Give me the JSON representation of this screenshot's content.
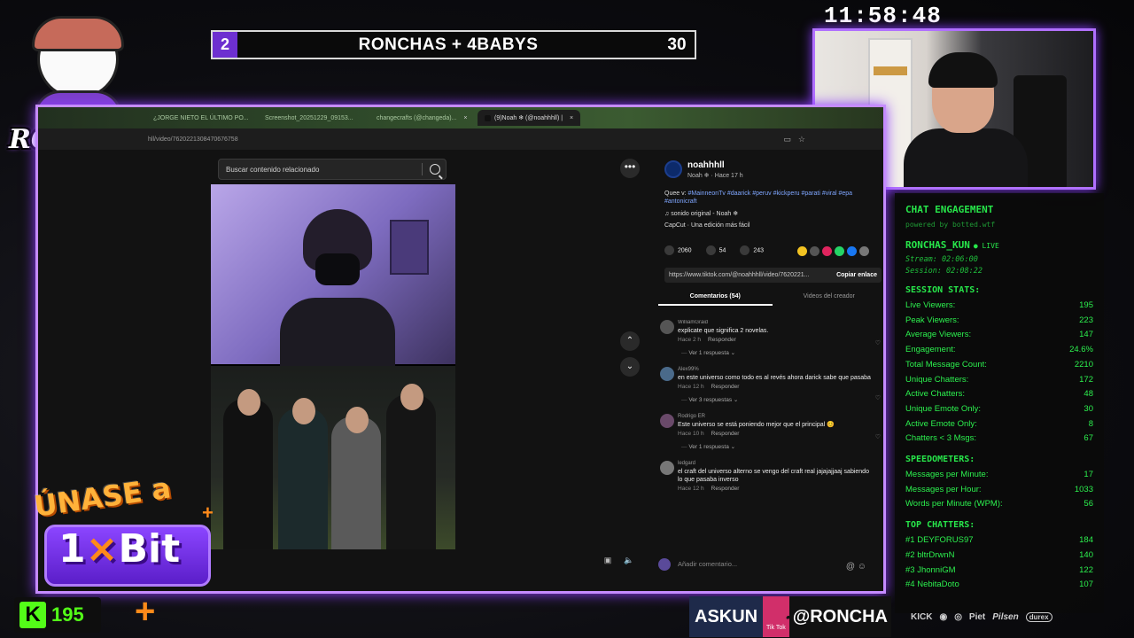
{
  "overlay": {
    "clock": "11:58:48",
    "scoreboard": {
      "left_score": "2",
      "title": "RONCHAS + 4BABYS",
      "right_score": "30"
    },
    "logo_text": "RONCHAS",
    "kick_viewers": "195",
    "promo": {
      "line1": "ÚNASE a",
      "brand_num": "1",
      "brand_x": "×",
      "brand_name": "Bit"
    },
    "ticker": {
      "left_text": "ASKUN",
      "tiktok_label": "Tik Tok",
      "right_text": "@RONCHA"
    },
    "sponsors": [
      "KICK",
      "Piet",
      "Pilsen",
      "durex"
    ]
  },
  "browser": {
    "tabs": [
      {
        "label": "¿JORGE NIETO EL ÚLTIMO PO...",
        "active": false
      },
      {
        "label": "Screenshot_20251229_09153...",
        "active": false
      },
      {
        "label": "changecrafts (@changeda)...",
        "active": false
      },
      {
        "label": "(9)Noah ❄ (@noahhhll) |",
        "active": true
      }
    ],
    "url": "hll/video/7620221308470676758"
  },
  "tiktok": {
    "search_placeholder": "Buscar contenido relacionado",
    "author": {
      "name": "noahhhll",
      "meta": "Noah ❄ · Hace 17 h"
    },
    "description_prefix": "Quee v: ",
    "hashtags": "#MainneonTv #daarick #peruv #kickperu #parati #viral #epa #antonicraft",
    "music": "♫ sonido original - Noah ❄",
    "capcut": "CapCut · Una edición más fácil",
    "stats": {
      "likes": "2060",
      "comments": "54",
      "saves": "243"
    },
    "link": "https://www.tiktok.com/@noahhhll/video/7620221...",
    "copy_label": "Copiar enlace",
    "tabs": {
      "comments": "Comentarios (54)",
      "creator": "Videos del creador"
    },
    "comments": [
      {
        "user": "WilliamGraid",
        "text": "explicate que significa 2 novelas.",
        "time": "Hace 2 h",
        "reply": "Responder",
        "more": "Ver 1 respuesta ⌄"
      },
      {
        "user": "Alex99%",
        "text": "en este universo como todo es al revés ahora darick sabe que pasaba",
        "time": "Hace 12 h",
        "reply": "Responder",
        "more": "Ver 3 respuestas ⌄"
      },
      {
        "user": "Rodrigo ER",
        "text": "Este universo se está poniendo mejor que el principal 😊",
        "time": "Hace 10 h",
        "reply": "Responder",
        "more": "Ver 1 respuesta ⌄"
      },
      {
        "user": "ledgard",
        "text": "el craft del universo alterno se vengo del craft real jajajajjaaj sabiendo lo que pasaba inverso",
        "time": "Hace 12 h",
        "reply": "Responder",
        "more": ""
      }
    ],
    "add_comment_placeholder": "Añadir comentario..."
  },
  "engagement": {
    "title": "CHAT ENGAGEMENT",
    "powered": "powered by botted.wtf",
    "user": "RONCHAS_KUN",
    "live": "● LIVE",
    "stream": "Stream: 02:06:00",
    "session": "Session: 02:08:22",
    "session_stats_title": "SESSION STATS:",
    "session_stats": [
      {
        "label": "Live Viewers:",
        "value": "195"
      },
      {
        "label": "Peak Viewers:",
        "value": "223"
      },
      {
        "label": "Average Viewers:",
        "value": "147"
      },
      {
        "label": "Engagement:",
        "value": "24.6%"
      },
      {
        "label": "Total Message Count:",
        "value": "2210"
      },
      {
        "label": "Unique Chatters:",
        "value": "172"
      },
      {
        "label": "Active Chatters:",
        "value": "48"
      },
      {
        "label": "Unique Emote Only:",
        "value": "30"
      },
      {
        "label": "Active Emote Only:",
        "value": "8"
      },
      {
        "label": "Chatters < 3 Msgs:",
        "value": "67"
      }
    ],
    "speed_title": "SPEEDOMETERS:",
    "speed": [
      {
        "label": "Messages per Minute:",
        "value": "17"
      },
      {
        "label": "Messages per Hour:",
        "value": "1033"
      },
      {
        "label": "Words per Minute (WPM):",
        "value": "56"
      }
    ],
    "top_title": "TOP CHATTERS:",
    "top": [
      {
        "label": "#1 DEYFORUS97",
        "value": "184"
      },
      {
        "label": "#2 bltrDrwnN",
        "value": "140"
      },
      {
        "label": "#3 JhonniGM",
        "value": "122"
      },
      {
        "label": "#4 NebitaDoto",
        "value": "107"
      }
    ]
  },
  "colors": {
    "neon_purple": "#c58bff",
    "chat_green": "#27e64a",
    "kick_green": "#53fc18",
    "score_purple": "#6d2fd0"
  }
}
